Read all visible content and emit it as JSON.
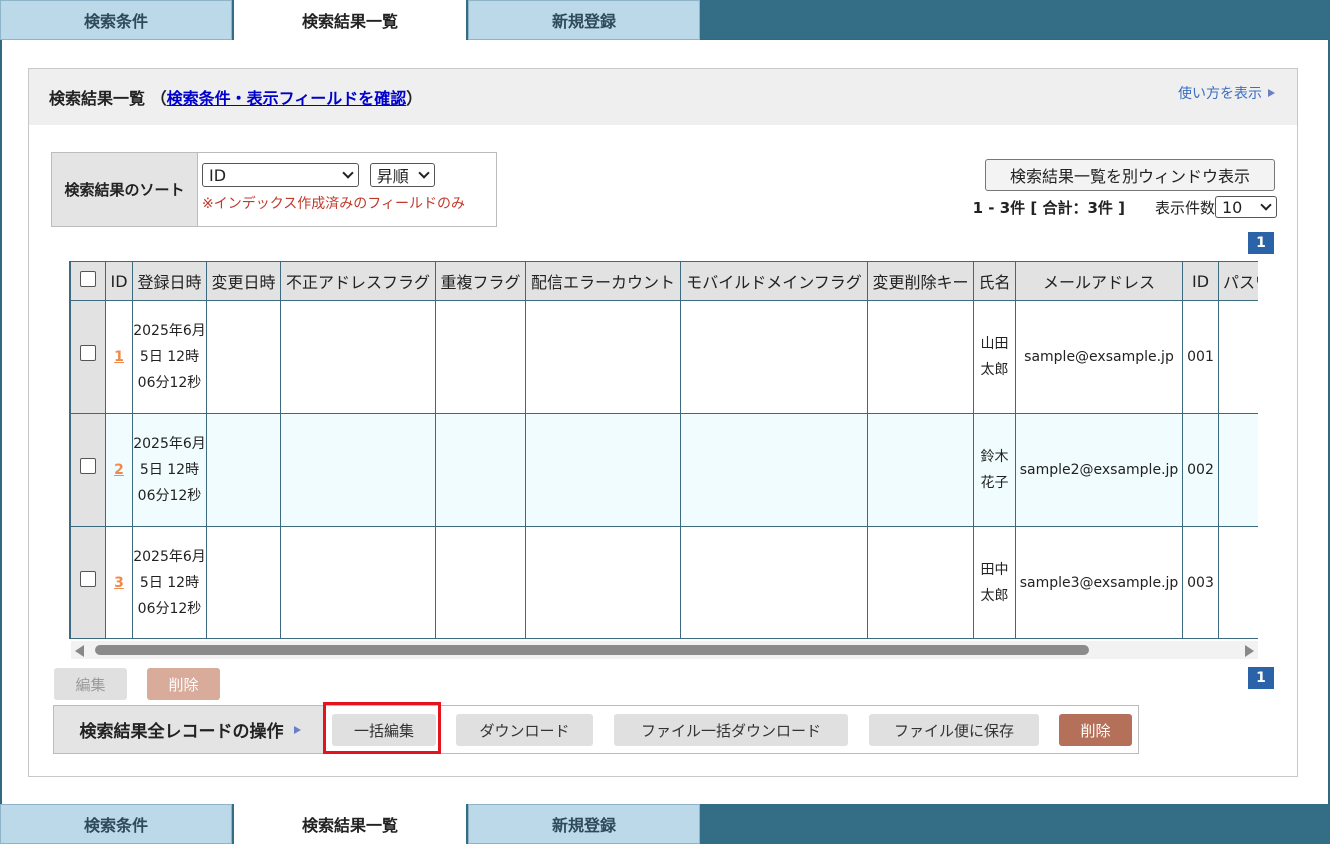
{
  "tabs": [
    {
      "label": "検索条件",
      "active": false
    },
    {
      "label": "検索結果一覧",
      "active": true
    },
    {
      "label": "新規登録",
      "active": false
    }
  ],
  "header": {
    "title_prefix": "検索結果一覧 （",
    "title_link": "検索条件・表示フィールドを確認",
    "title_suffix": "）",
    "howto": "使い方を表示"
  },
  "sort": {
    "label": "検索結果のソート",
    "field_value": "ID",
    "order_value": "昇順",
    "note": "※インデックス作成済みのフィールドのみ"
  },
  "toolbar": {
    "window_button": "検索結果一覧を別ウィンドウ表示",
    "count": "1 - 3件 [ 合計：3件 ]",
    "per_page_label": "表示件数",
    "per_page_value": "10",
    "page": "1"
  },
  "table": {
    "headers": [
      "ID",
      "登録日時",
      "変更日時",
      "不正アドレスフラグ",
      "重複フラグ",
      "配信エラーカウント",
      "モバイルドメインフラグ",
      "変更削除キー",
      "氏名",
      "メールアドレス",
      "ID",
      "パスワ"
    ],
    "rows": [
      {
        "id": "1",
        "registered": "2025年6月5日 12時06分12秒",
        "name": "山田太郎",
        "email": "sample@exsample.jp",
        "id2": "001"
      },
      {
        "id": "2",
        "registered": "2025年6月5日 12時06分12秒",
        "name": "鈴木花子",
        "email": "sample2@exsample.jp",
        "id2": "002"
      },
      {
        "id": "3",
        "registered": "2025年6月5日 12時06分12秒",
        "name": "田中太郎",
        "email": "sample3@exsample.jp",
        "id2": "003"
      }
    ]
  },
  "actions": {
    "edit": "編集",
    "delete": "削除"
  },
  "bulk": {
    "label": "検索結果全レコードの操作",
    "bulk_edit": "一括編集",
    "download": "ダウンロード",
    "file_download": "ファイル一括ダウンロード",
    "file_save": "ファイル便に保存",
    "delete": "削除"
  },
  "colors": {
    "tab_bar": "#336e86",
    "tab_inactive": "#bcd9ea",
    "link": "#0000cc",
    "id_link": "#f08a4b",
    "highlight": "#e3141c",
    "delete_button": "#b5705a"
  }
}
